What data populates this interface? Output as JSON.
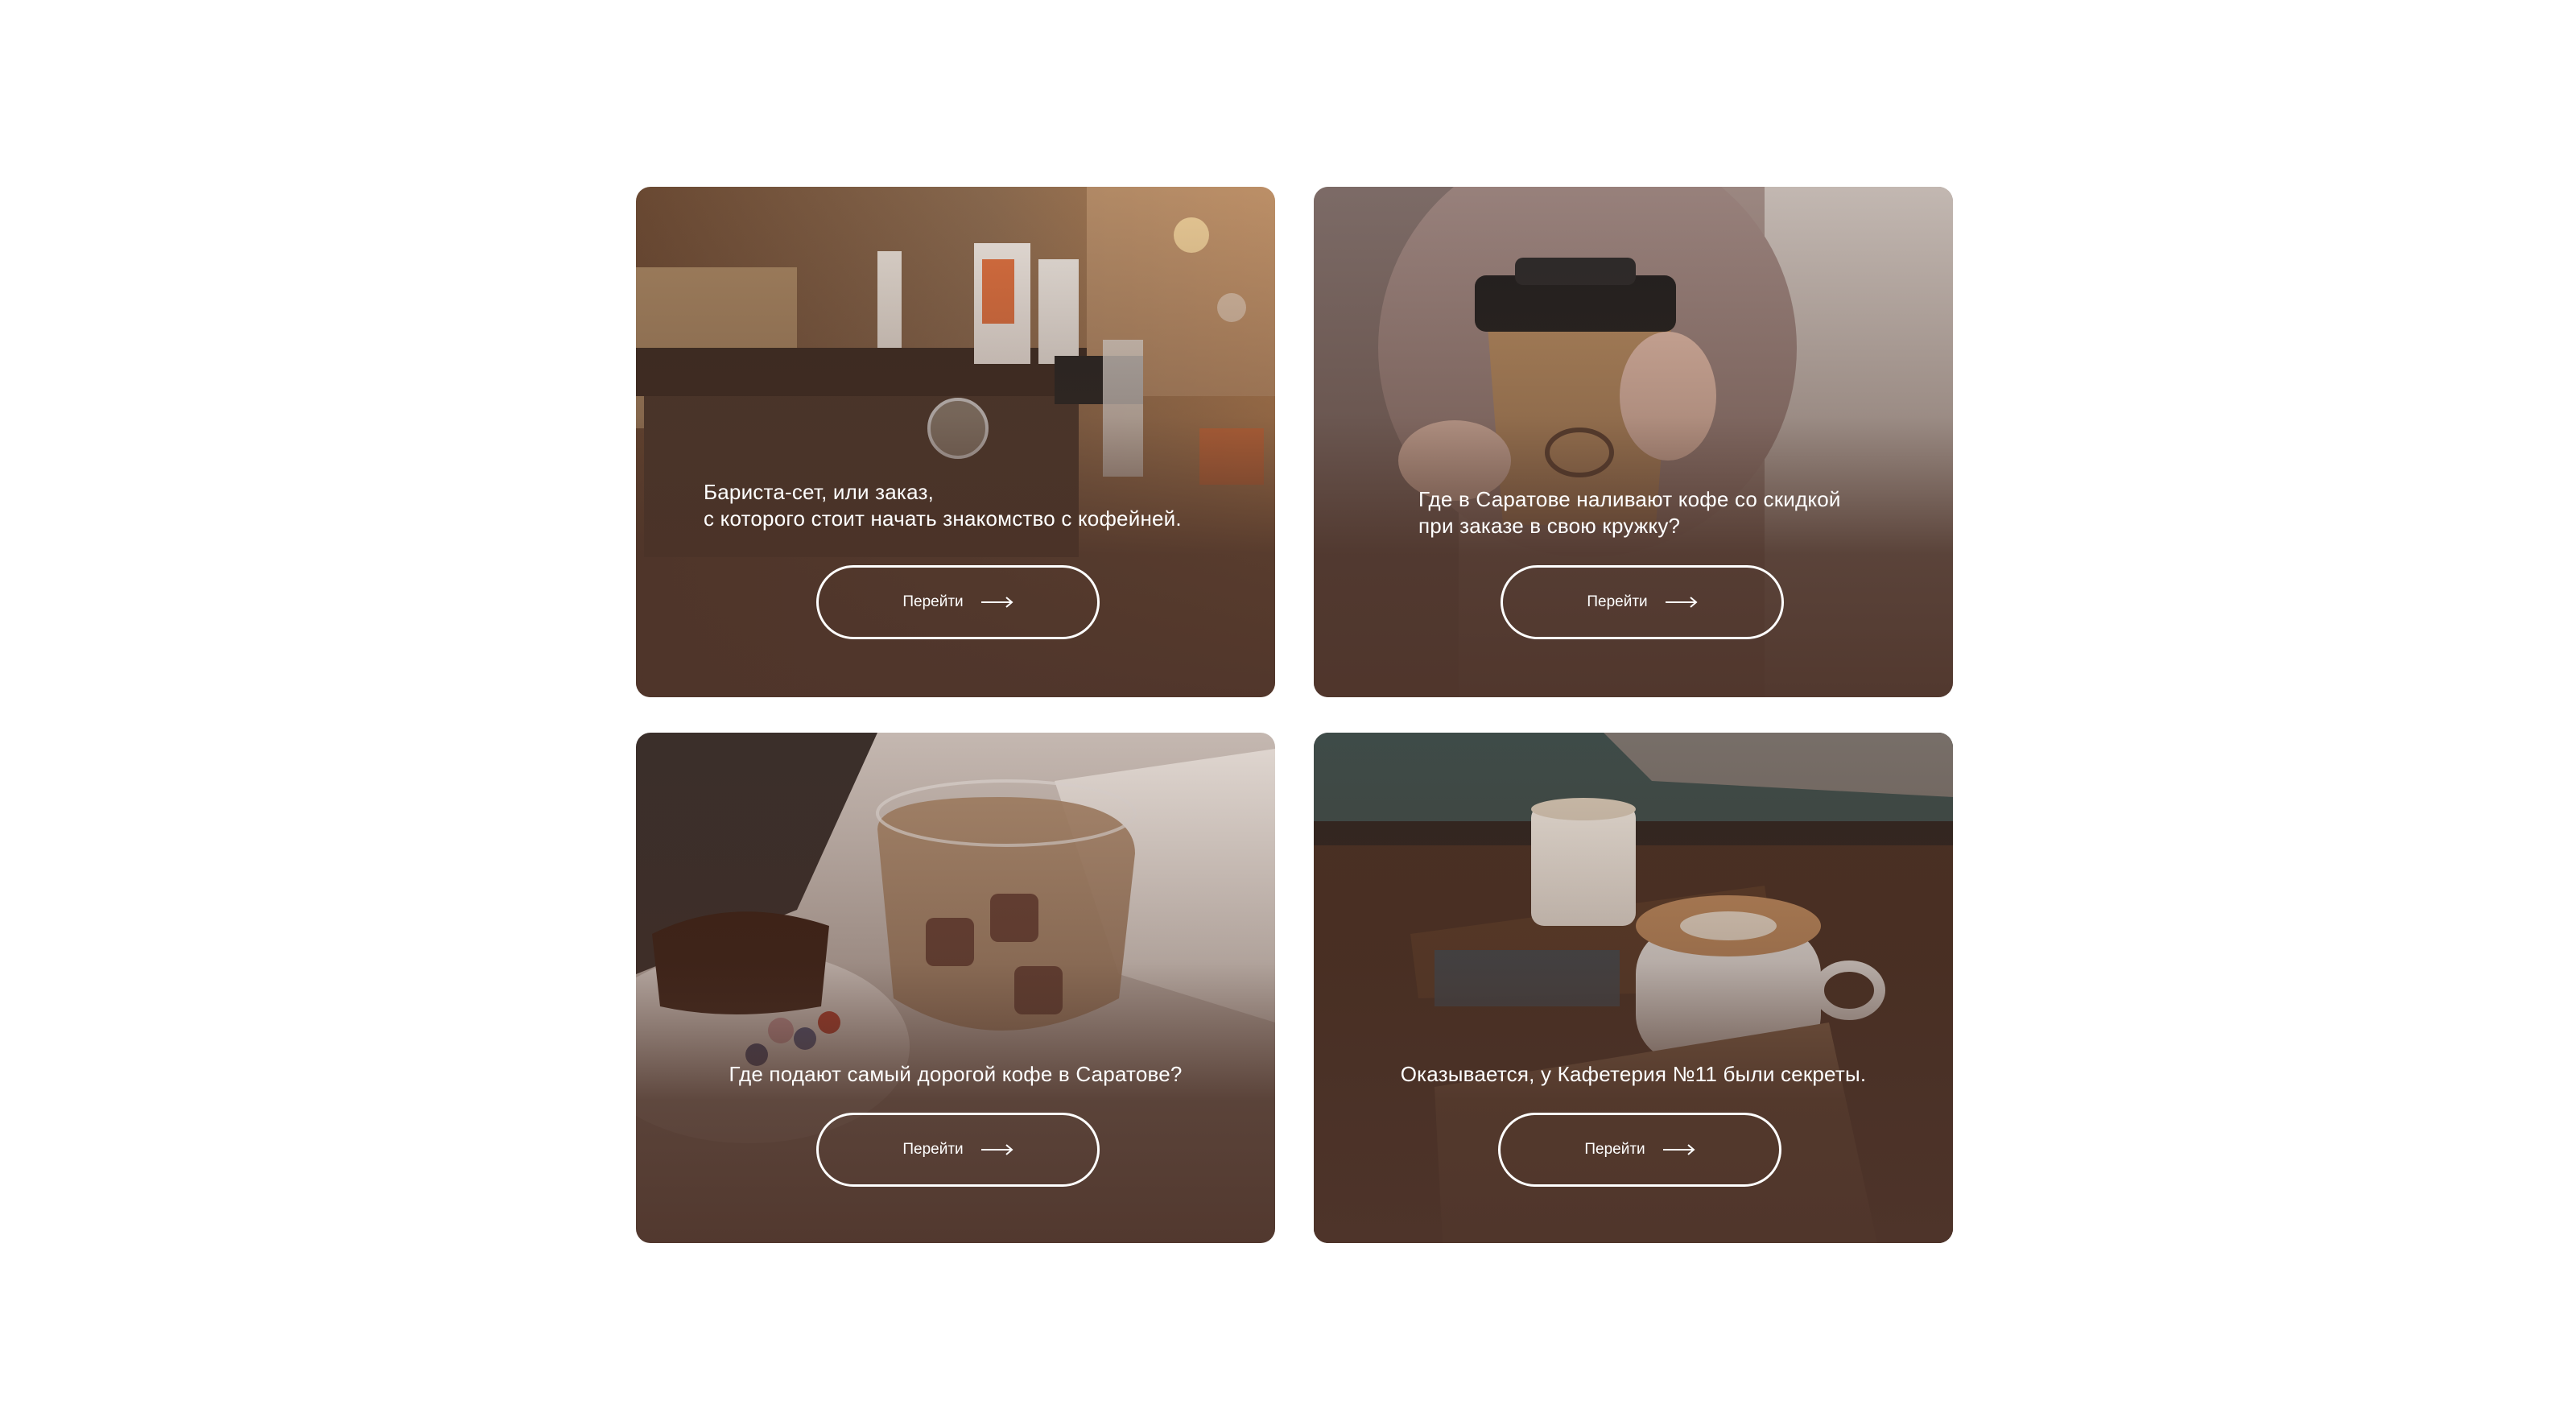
{
  "cards": [
    {
      "lines": [
        "Бариста-сет, или заказ,",
        "с которого стоит начать знакомство с кофейней."
      ],
      "button_label": "Перейти"
    },
    {
      "lines": [
        "Где в Саратове наливают кофе со скидкой",
        "при заказе в свою кружку?"
      ],
      "button_label": "Перейти"
    },
    {
      "lines": [
        "Где подают самый дорогой кофе в Саратове?"
      ],
      "button_label": "Перейти"
    },
    {
      "lines": [
        "Оказывается, у Кафетерия №11 были секреты."
      ],
      "button_label": "Перейти"
    }
  ],
  "colors": {
    "card_overlay": "#4e342a",
    "text": "#ffffff",
    "page_background": "#ffffff"
  },
  "icons": {
    "button": "arrow-right-icon"
  }
}
